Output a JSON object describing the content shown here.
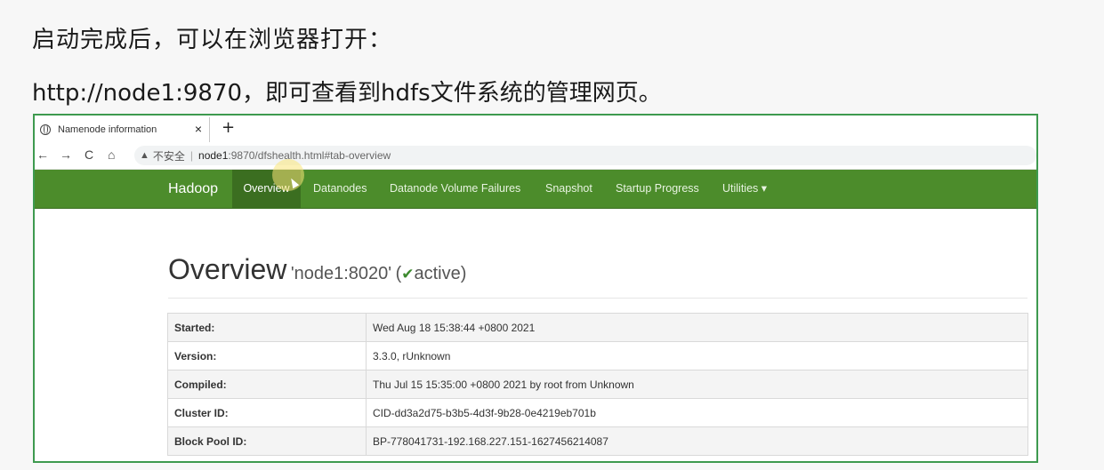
{
  "slide": {
    "line1": "启动完成后，可以在浏览器打开：",
    "line2": "http://node1:9870，即可查看到hdfs文件系统的管理网页。"
  },
  "browser": {
    "tab": {
      "title": "Namenode information",
      "close": "×",
      "new_tab": "+",
      "icon": "globe-icon"
    },
    "toolbar": {
      "back": "←",
      "forward": "→",
      "reload": "C",
      "home": "⌂",
      "security_icon": "▲",
      "security_text": "不安全",
      "separator": "|",
      "url_host": "node1",
      "url_path": ":9870/dfshealth.html#tab-overview"
    }
  },
  "hadoop": {
    "brand": "Hadoop",
    "nav": [
      {
        "label": "Overview",
        "active": true
      },
      {
        "label": "Datanodes",
        "active": false
      },
      {
        "label": "Datanode Volume Failures",
        "active": false
      },
      {
        "label": "Snapshot",
        "active": false
      },
      {
        "label": "Startup Progress",
        "active": false
      },
      {
        "label": "Utilities ▾",
        "active": false
      }
    ],
    "nav_color": "#4c8c2b",
    "overview": {
      "title": "Overview",
      "host": "'node1:8020'",
      "paren_open": "(",
      "check": "✔",
      "status": "active",
      "paren_close": ")"
    },
    "info": [
      {
        "key": "Started:",
        "value": "Wed Aug 18 15:38:44 +0800 2021"
      },
      {
        "key": "Version:",
        "value": "3.3.0, rUnknown"
      },
      {
        "key": "Compiled:",
        "value": "Thu Jul 15 15:35:00 +0800 2021 by root from Unknown"
      },
      {
        "key": "Cluster ID:",
        "value": "CID-dd3a2d75-b3b5-4d3f-9b28-0e4219eb701b"
      },
      {
        "key": "Block Pool ID:",
        "value": "BP-778041731-192.168.227.151-1627456214087"
      }
    ]
  }
}
